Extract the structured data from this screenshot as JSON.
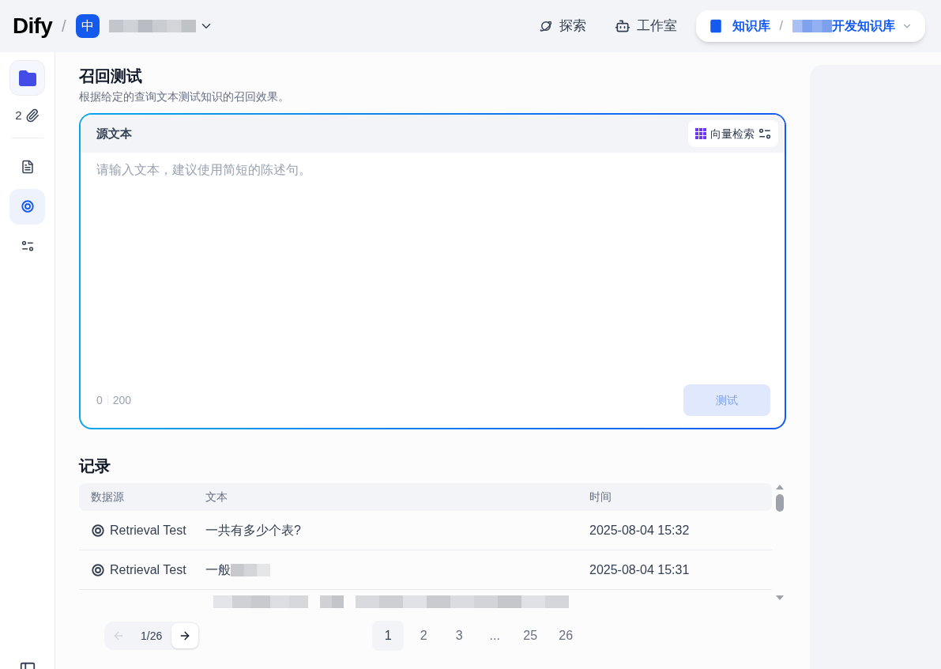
{
  "header": {
    "logo": "Dify",
    "logo_separator": "/",
    "workspace": {
      "avatar": "中",
      "redacted": true
    },
    "nav": [
      {
        "label": "探索",
        "kind": "planet",
        "selected": false
      },
      {
        "label": "工作室",
        "kind": "robot",
        "selected": false
      },
      {
        "label": "知识库",
        "kind": "book",
        "selected": true
      }
    ],
    "dataset_separator": "/",
    "dataset_name": "开发知识库"
  },
  "sidebar": {
    "doc_count": "2",
    "items": [
      {
        "kind": "document",
        "selected": false
      },
      {
        "kind": "target",
        "selected": true
      },
      {
        "kind": "settings",
        "selected": false
      }
    ]
  },
  "retrieval": {
    "title": "召回测试",
    "description": "根据给定的查询文本测试知识的召回效果。",
    "source_label": "源文本",
    "method": "向量检索",
    "placeholder": "请输入文本，建议使用简短的陈述句。",
    "count": "0",
    "limit": "200",
    "submit": "测试",
    "submit_disabled": true
  },
  "records": {
    "title": "记录",
    "columns": [
      "数据源",
      "文本",
      "时间"
    ],
    "rows": [
      {
        "source": "Retrieval Test",
        "text": "一共有多少个表?",
        "time": "2025-08-04 15:32",
        "redacted": false
      },
      {
        "source": "Retrieval Test",
        "text": "一般",
        "time": "2025-08-04 15:31",
        "redacted": true
      }
    ]
  },
  "pagination": {
    "indicator": "1/26",
    "prev_disabled": true,
    "pages": [
      {
        "label": "1",
        "selected": true
      },
      {
        "label": "2",
        "selected": false
      },
      {
        "label": "3",
        "selected": false
      },
      {
        "label": "...",
        "selected": false
      },
      {
        "label": "25",
        "selected": false
      },
      {
        "label": "26",
        "selected": false
      }
    ]
  }
}
